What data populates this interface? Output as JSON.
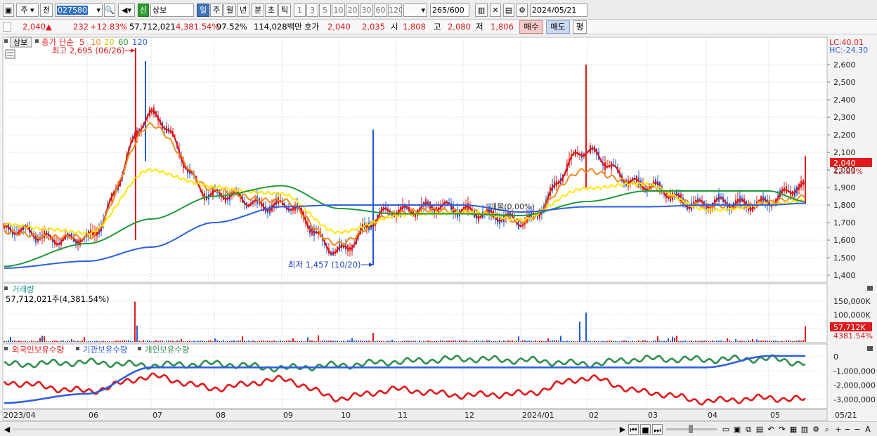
{
  "toolbar": {
    "type_label": "주",
    "prev_label": "전",
    "code_value": "027580",
    "name_badge": "신",
    "stock_name": "상보",
    "period_tabs": [
      "일",
      "주",
      "월",
      "년",
      "분",
      "초",
      "틱"
    ],
    "active_period": "일",
    "interval_options": [
      "1",
      "3",
      "5",
      "10",
      "20",
      "30",
      "60",
      "120"
    ],
    "count_value": "265",
    "count_total": "/600",
    "date_value": "2024/05/21"
  },
  "info": {
    "price": "2,040",
    "price_arrow": "▲",
    "change": "232",
    "change_pct": "+12.83%",
    "volume": "57,712,021",
    "volume_pct": "4,381.54%",
    "turnover": "97.52%",
    "amount": "114,028백만",
    "quote_label": "호가",
    "ask": "2,040",
    "bid": "2,035",
    "open_label": "시",
    "open": "1,808",
    "high_label": "고",
    "high": "2,080",
    "low_label": "저",
    "low": "1,806",
    "buy_label": "매수",
    "sell_label": "매도",
    "avg_label": "평"
  },
  "price_panel": {
    "stock_tag": "상보",
    "legend_title": "종가 단순",
    "ma_labels": [
      "5",
      "10",
      "20",
      "60",
      "120"
    ],
    "max_note": "최고 2,695 (06/26)",
    "min_note": "최저 1,457 (10/20)",
    "vp_note": "매물(0.00%)",
    "lc_label": "LC:40.01",
    "hc_label": "HC:-24.30",
    "y_ticks": [
      "2,600",
      "2,500",
      "2,400",
      "2,300",
      "2,200",
      "2,100",
      "2,000",
      "1,900",
      "1,800",
      "1,700",
      "1,600",
      "1,500",
      "1,400"
    ],
    "y_tick_values": [
      2600,
      2500,
      2400,
      2300,
      2200,
      2100,
      2000,
      1900,
      1800,
      1700,
      1600,
      1500,
      1400
    ],
    "last_price": "2,040",
    "last_pct": "12.83%"
  },
  "volume_panel": {
    "title": "거래량",
    "value_note": "57,712,021주(4,381.54%)",
    "y_ticks": [
      "150,000K",
      "100,000K",
      "50,000K"
    ],
    "y_tick_values": [
      150000,
      100000,
      50000
    ],
    "last_volume": "57,712K",
    "last_pct": "4381.54%"
  },
  "holding_panel": {
    "series_labels": [
      "외국인보유수량",
      "기관보유수량",
      "개인보유수량"
    ],
    "y_ticks": [
      "0",
      "-1,000,000",
      "-2,000,000",
      "-3,000,000"
    ],
    "y_tick_values": [
      0,
      -1000000,
      -2000000,
      -3000000
    ]
  },
  "x_axis": {
    "labels": [
      "2023/04",
      "06",
      "07",
      "08",
      "09",
      "10",
      "11",
      "12",
      "2024/01",
      "02",
      "03",
      "04",
      "05",
      "05/21"
    ]
  },
  "colors": {
    "up": "#e0191a",
    "down": "#1f5bd6",
    "ma5": "#e0191a",
    "ma10": "#f08a1c",
    "ma20": "#ffe600",
    "ma60": "#1f9a3a",
    "ma120": "#2f5fe0",
    "foreign": "#2f8f4e",
    "institution": "#e0191a",
    "individual": "#2f5fe0"
  },
  "chart_data": {
    "type": "line",
    "title": "",
    "ylim": [
      1400,
      2650
    ],
    "series": [
      {
        "name": "5",
        "x": [
          "2023/04",
          "06",
          "07",
          "08",
          "09",
          "10",
          "11",
          "12",
          "2024/01",
          "02",
          "03",
          "04",
          "05",
          "05/21"
        ],
        "values": [
          1650,
          1600,
          2300,
          1850,
          1800,
          1550,
          1780,
          1780,
          1700,
          2100,
          1900,
          1800,
          1820,
          1900
        ]
      },
      {
        "name": "10",
        "x": [
          "2023/04",
          "06",
          "07",
          "08",
          "09",
          "10",
          "11",
          "12",
          "2024/01",
          "02",
          "03",
          "04",
          "05",
          "05/21"
        ],
        "values": [
          1640,
          1610,
          2250,
          1880,
          1820,
          1580,
          1760,
          1770,
          1710,
          2000,
          1900,
          1790,
          1810,
          1850
        ]
      },
      {
        "name": "20",
        "x": [
          "2023/04",
          "06",
          "07",
          "08",
          "09",
          "10",
          "11",
          "12",
          "2024/01",
          "02",
          "03",
          "04",
          "05",
          "05/21"
        ],
        "values": [
          1690,
          1640,
          2000,
          1900,
          1860,
          1640,
          1740,
          1760,
          1720,
          1900,
          1920,
          1770,
          1800,
          1830
        ]
      },
      {
        "name": "60",
        "x": [
          "2023/04",
          "06",
          "07",
          "08",
          "09",
          "10",
          "11",
          "12",
          "2024/01",
          "02",
          "03",
          "04",
          "05",
          "05/21"
        ],
        "values": [
          1450,
          1580,
          1720,
          1850,
          1910,
          1780,
          1750,
          1750,
          1740,
          1820,
          1880,
          1880,
          1880,
          1820
        ]
      },
      {
        "name": "120",
        "x": [
          "2023/04",
          "06",
          "07",
          "08",
          "09",
          "10",
          "11",
          "12",
          "2024/01",
          "02",
          "03",
          "04",
          "05",
          "05/21"
        ],
        "values": [
          1440,
          1480,
          1560,
          1700,
          1790,
          1800,
          1800,
          1800,
          1760,
          1790,
          1790,
          1800,
          1800,
          1810
        ]
      }
    ]
  }
}
